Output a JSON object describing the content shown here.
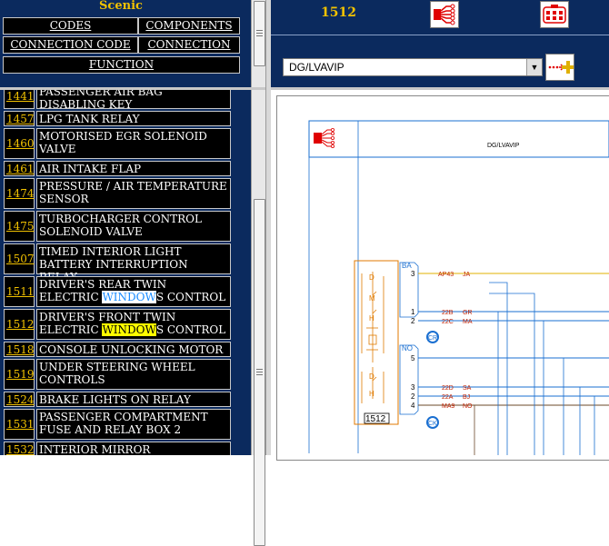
{
  "app": {
    "title": "Scenic"
  },
  "nav": {
    "codes": "CODES",
    "components": "COMPONENTS",
    "connection_code": "CONNECTION CODE",
    "connection": "CONNECTION",
    "function": "FUNCTION"
  },
  "header": {
    "connector_number": "1512",
    "harness_icon": "harness-connector-icon",
    "connector_icon": "connector-plug-icon",
    "add_icon": "add-plus-icon"
  },
  "select": {
    "value": "DG/LVAVIP"
  },
  "list": [
    {
      "code": "1441",
      "name": "PASSENGER AIR BAG DISABLING KEY"
    },
    {
      "code": "1457",
      "name": "LPG TANK RELAY"
    },
    {
      "code": "1460",
      "name": "MOTORISED EGR SOLENOID VALVE"
    },
    {
      "code": "1461",
      "name": "AIR INTAKE FLAP"
    },
    {
      "code": "1474",
      "name": "PRESSURE / AIR TEMPERATURE SENSOR"
    },
    {
      "code": "1475",
      "name": "TURBOCHARGER CONTROL SOLENOID VALVE"
    },
    {
      "code": "1507",
      "name": "TIMED INTERIOR LIGHT BATTERY INTERRUPTION RELAY"
    },
    {
      "code": "1511",
      "name_pre": "DRIVER'S REAR TWIN ELECTRIC ",
      "name_hl": "WINDOW",
      "name_post": "S CONTROL",
      "hl": "w"
    },
    {
      "code": "1512",
      "name_pre": "DRIVER'S FRONT TWIN ELECTRIC ",
      "name_hl": "WINDOW",
      "name_post": "S CONTROL",
      "hl": "y"
    },
    {
      "code": "1518",
      "name": "CONSOLE UNLOCKING MOTOR"
    },
    {
      "code": "1519",
      "name": "UNDER STEERING WHEEL CONTROLS"
    },
    {
      "code": "1524",
      "name": "BRAKE LIGHTS ON RELAY"
    },
    {
      "code": "1531",
      "name": "PASSENGER COMPARTMENT FUSE AND RELAY BOX 2"
    },
    {
      "code": "1532",
      "name": "INTERIOR MIRROR"
    }
  ],
  "diagram": {
    "header_label": "DG/LVAVIP",
    "component_id": "1512",
    "connector_ba": "BA",
    "connector_no": "NO",
    "pins_ba": [
      {
        "pin": "3",
        "wire": "AP43",
        "code": "JA",
        "color": "#e0b000"
      },
      {
        "pin": "1",
        "wire": "22B",
        "code": "GR",
        "color": "#1a6fd1"
      },
      {
        "pin": "2",
        "wire": "22C",
        "code": "MA",
        "color": "#1a6fd1"
      }
    ],
    "pins_no": [
      {
        "pin": "5",
        "wire": "",
        "code": "",
        "color": "#1a6fd1"
      },
      {
        "pin": "3",
        "wire": "22D",
        "code": "SA",
        "color": "#1a6fd1"
      },
      {
        "pin": "2",
        "wire": "22A",
        "code": "BJ",
        "color": "#1a6fd1"
      },
      {
        "pin": "4",
        "wire": "MA9",
        "code": "NO",
        "color": "#1a6fd1"
      }
    ],
    "switch_labels": [
      "D",
      "M",
      "H",
      "D",
      "H"
    ],
    "badge_cr": "CR",
    "badge_ck": "CK",
    "colors": {
      "frame": "#e07a00",
      "wire": "#1a6fd1",
      "feed": "#e0b000",
      "ground": "#6b4a2a"
    }
  }
}
